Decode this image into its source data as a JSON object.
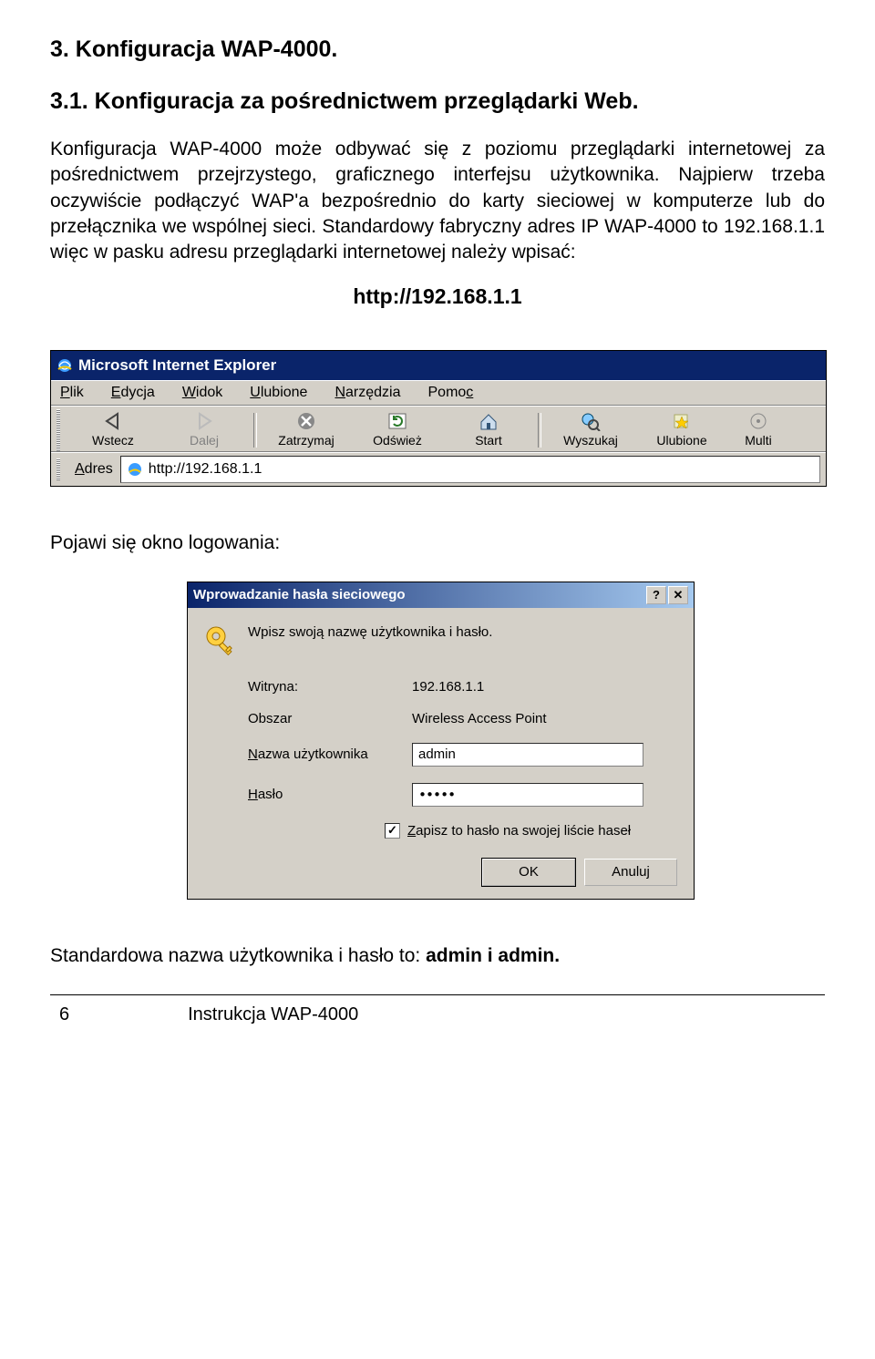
{
  "doc": {
    "h1": "3. Konfiguracja WAP-4000.",
    "h2": "3.1. Konfiguracja za pośrednictwem przeglądarki Web.",
    "p1": "Konfiguracja WAP-4000 może odbywać się z poziomu przeglądarki internetowej za pośrednictwem przejrzystego, graficznego interfejsu użytkownika. Najpierw trzeba oczywiście podłączyć WAP'a bezpośrednio do karty sieciowej w komputerze lub do przełącznika we wspólnej sieci. Standardowy fabryczny adres IP WAP-4000 to 192.168.1.1 więc w pasku adresu przeglądarki internetowej należy wpisać:",
    "url": "http://192.168.1.1",
    "p2": "Pojawi się okno logowania:",
    "p3_pre": "Standardowa nazwa użytkownika i hasło to: ",
    "p3_bold": "admin i admin.",
    "page_num": "6",
    "footer": "Instrukcja WAP-4000"
  },
  "ie": {
    "title": "Microsoft Internet Explorer",
    "menu": {
      "plik": "Plik",
      "edycja": "Edycja",
      "widok": "Widok",
      "ulubione": "Ulubione",
      "narzedzia": "Narzędzia",
      "pomoc": "Pomoc"
    },
    "tb": {
      "wstecz": "Wstecz",
      "dalej": "Dalej",
      "zatrzymaj": "Zatrzymaj",
      "odswiez": "Odśwież",
      "start": "Start",
      "wyszukaj": "Wyszukaj",
      "ulubione": "Ulubione",
      "multi": "Multi"
    },
    "adres_label": "Adres",
    "adres_value": "http://192.168.1.1"
  },
  "dialog": {
    "title": "Wprowadzanie hasła sieciowego",
    "prompt": "Wpisz swoją nazwę użytkownika i hasło.",
    "witryna_l": "Witryna:",
    "witryna_v": "192.168.1.1",
    "obszar_l": "Obszar",
    "obszar_v": "Wireless Access Point",
    "user_l": "Nazwa użytkownika",
    "user_v": "admin",
    "pass_l": "Hasło",
    "pass_v": "•••••",
    "save_l": "Zapisz to hasło na swojej liście haseł",
    "ok": "OK",
    "cancel": "Anuluj"
  }
}
